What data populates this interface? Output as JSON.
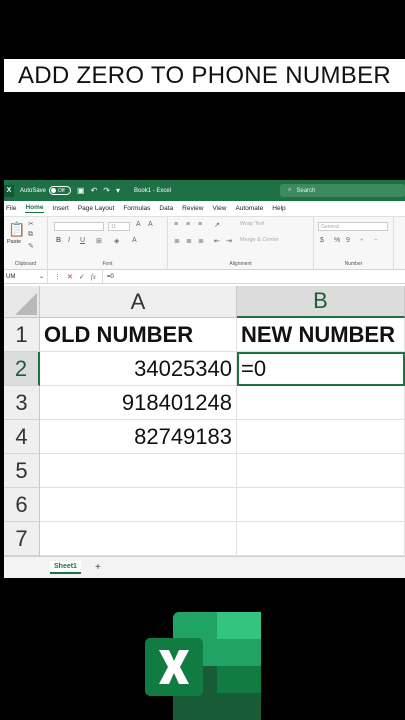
{
  "banner": {
    "title": "ADD ZERO TO PHONE NUMBER"
  },
  "titlebar": {
    "autosave_label": "AutoSave",
    "autosave_state": "Off",
    "doc_title": "Book1 - Excel",
    "search_placeholder": "Search"
  },
  "tabs": [
    "File",
    "Home",
    "Insert",
    "Page Layout",
    "Formulas",
    "Data",
    "Review",
    "View",
    "Automate",
    "Help"
  ],
  "active_tab": "Home",
  "ribbon": {
    "paste_label": "Paste",
    "clipboard_group": "Clipboard",
    "font_group": "Font",
    "alignment_group": "Alignment",
    "number_group": "Number",
    "wrap_text": "Wrap Text",
    "merge_center": "Merge & Center",
    "number_format": "General",
    "font_size": "11"
  },
  "formula_bar": {
    "name_box": "UM",
    "formula": "=0",
    "fx": "fx"
  },
  "grid": {
    "columns": [
      "A",
      "B"
    ],
    "rows": [
      {
        "num": "1",
        "a": "OLD NUMBER",
        "b": "NEW NUMBER"
      },
      {
        "num": "2",
        "a": "34025340",
        "b": "=0"
      },
      {
        "num": "3",
        "a": "918401248",
        "b": ""
      },
      {
        "num": "4",
        "a": "82749183",
        "b": ""
      },
      {
        "num": "5",
        "a": "",
        "b": ""
      },
      {
        "num": "6",
        "a": "",
        "b": ""
      },
      {
        "num": "7",
        "a": "",
        "b": ""
      }
    ]
  },
  "sheets": {
    "active": "Sheet1",
    "add_label": "+"
  },
  "colors": {
    "excel_green": "#1e7145",
    "banner_bg": "#ffffff",
    "page_bg": "#000000"
  }
}
